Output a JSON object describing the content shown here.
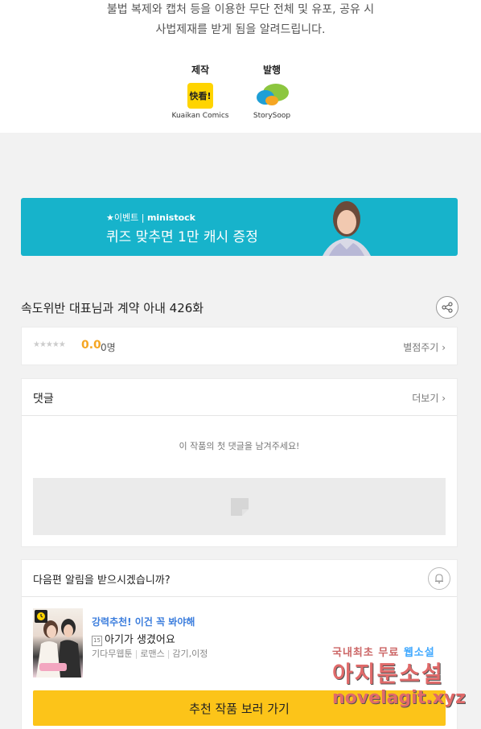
{
  "notice": {
    "line1": "불법 복제와 캡처 등을 이용한 무단 전체 및 유포, 공유 시",
    "line2": "사법제재를 받게 됨을 알려드립니다."
  },
  "credits": {
    "producer_label": "제작",
    "producer_logo_text": "快看!",
    "producer_name": "Kuaikan Comics",
    "publisher_label": "발행",
    "publisher_name": "StorySoop"
  },
  "banner": {
    "event_label": "★이벤트 |",
    "brand": "ministock",
    "headline": "퀴즈 맞추면 1만 캐시 증정"
  },
  "episode": {
    "title": "속도위반 대표님과 계약 아내 426화"
  },
  "rating": {
    "stars": "★★★★★",
    "score": "0.0",
    "count": "0명",
    "rate_link": "별점주기"
  },
  "comments": {
    "title": "댓글",
    "more": "더보기",
    "empty_message": "이 작품의 첫 댓글을 남겨주세요!"
  },
  "alarm": {
    "question": "다음편 알림을 받으시겠습니까?"
  },
  "recommendation": {
    "label": "강력추천! 이건 꼭 봐야해",
    "age_badge": "15",
    "title": "아기가 생겼어요",
    "publisher": "기다무웹툰",
    "genre": "로맨스",
    "tags": "감기,이정",
    "cta": "추천 작품 보러 가기"
  },
  "watermark": {
    "line1a": "국내최초 무료",
    "line1b": "웹소설",
    "line2": "아지툰소설",
    "line3": "novelagit.xyz"
  },
  "colors": {
    "banner_bg": "#17b3cb",
    "score": "#f5a623",
    "cta_bg": "#fcc419",
    "rec_label": "#3b7ddd"
  }
}
